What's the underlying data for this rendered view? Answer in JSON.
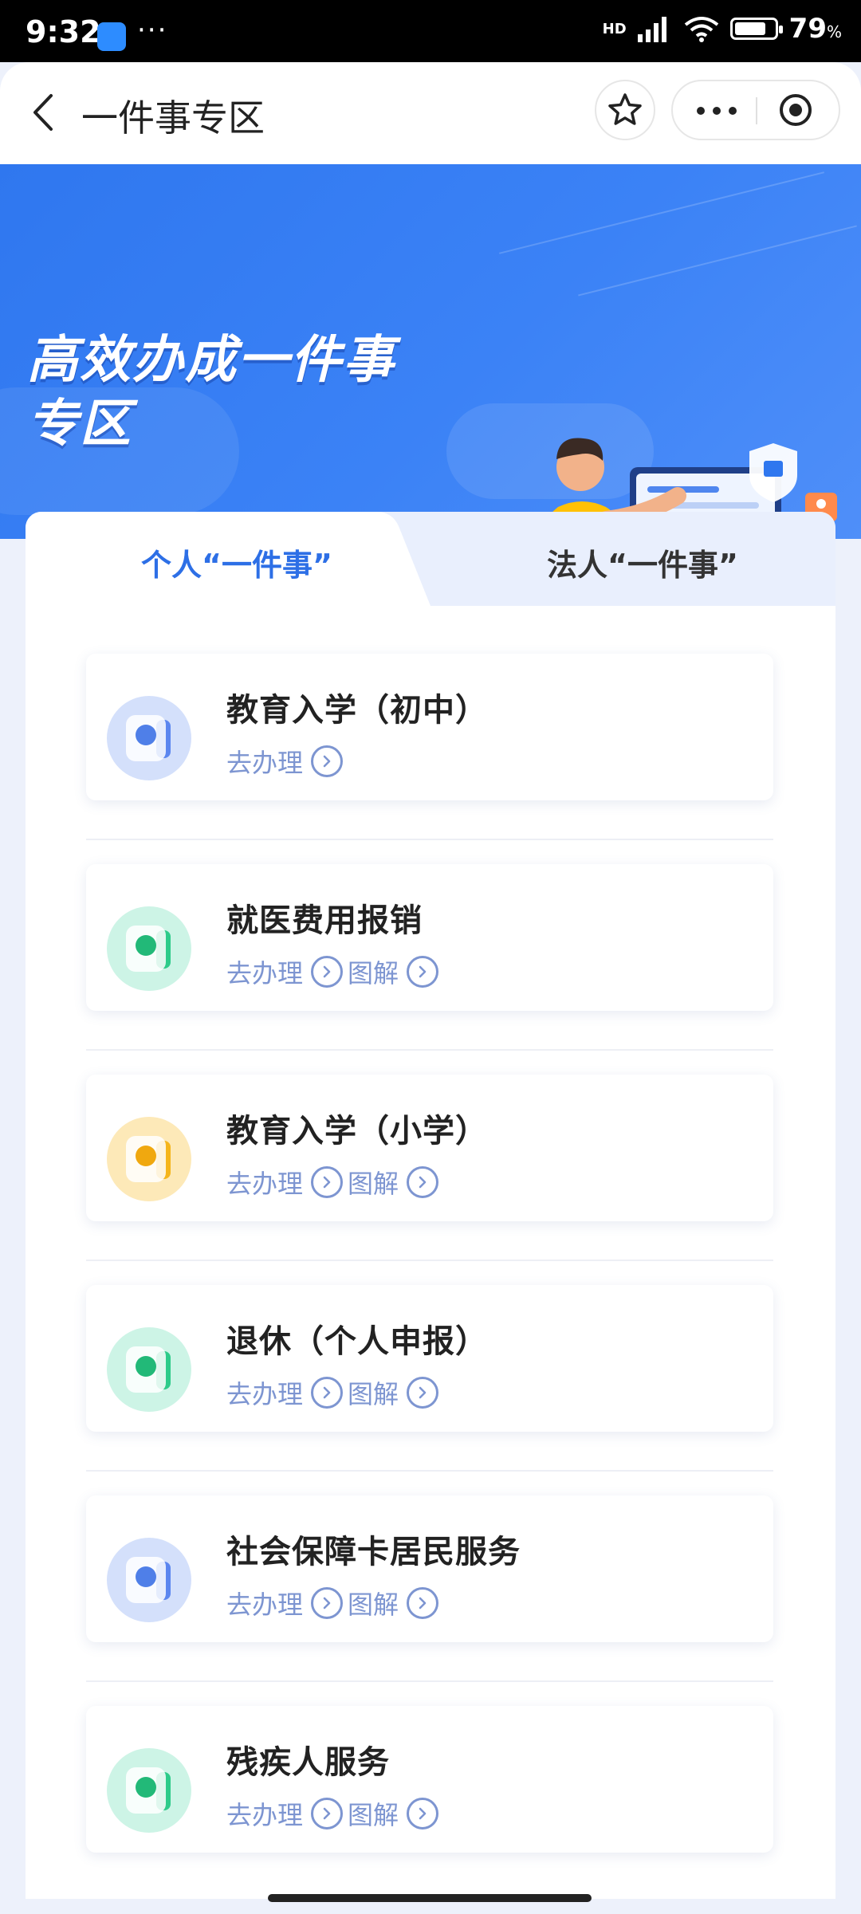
{
  "status_bar": {
    "time": "9:32",
    "dots": "···",
    "network": "HD",
    "battery_percent": "79",
    "battery_unit": "%",
    "battery_level": 0.79
  },
  "header": {
    "title": "一件事专区",
    "icons": [
      "back-arrow-icon",
      "star-icon",
      "more-icon",
      "target-icon"
    ]
  },
  "banner": {
    "title_line1": "高效办成一件事",
    "title_line2": "专区"
  },
  "tabs": [
    {
      "label": "个人“一件事”",
      "active": true
    },
    {
      "label": "法人“一件事”",
      "active": false
    }
  ],
  "colors": {
    "accent": "#2d6fe6",
    "action_text": "#7d95d1",
    "banner": "#3b82f6"
  },
  "items": [
    {
      "title": "教育入学（初中）",
      "action": "去办理",
      "diagram": "",
      "icon_color": "blue",
      "icon": "person-icon"
    },
    {
      "title": "就医费用报销",
      "action": "去办理",
      "diagram": "图解",
      "icon_color": "green",
      "icon": "medical-box-icon"
    },
    {
      "title": "教育入学（小学）",
      "action": "去办理",
      "diagram": "图解",
      "icon_color": "yellow",
      "icon": "shield-icon"
    },
    {
      "title": "退休（个人申报）",
      "action": "去办理",
      "diagram": "图解",
      "icon_color": "green",
      "icon": "wheelchair-icon"
    },
    {
      "title": "社会保障卡居民服务",
      "action": "去办理",
      "diagram": "图解",
      "icon_color": "blue",
      "icon": "person-icon"
    },
    {
      "title": "残疾人服务",
      "action": "去办理",
      "diagram": "图解",
      "icon_color": "green",
      "icon": "medical-box-icon"
    }
  ]
}
